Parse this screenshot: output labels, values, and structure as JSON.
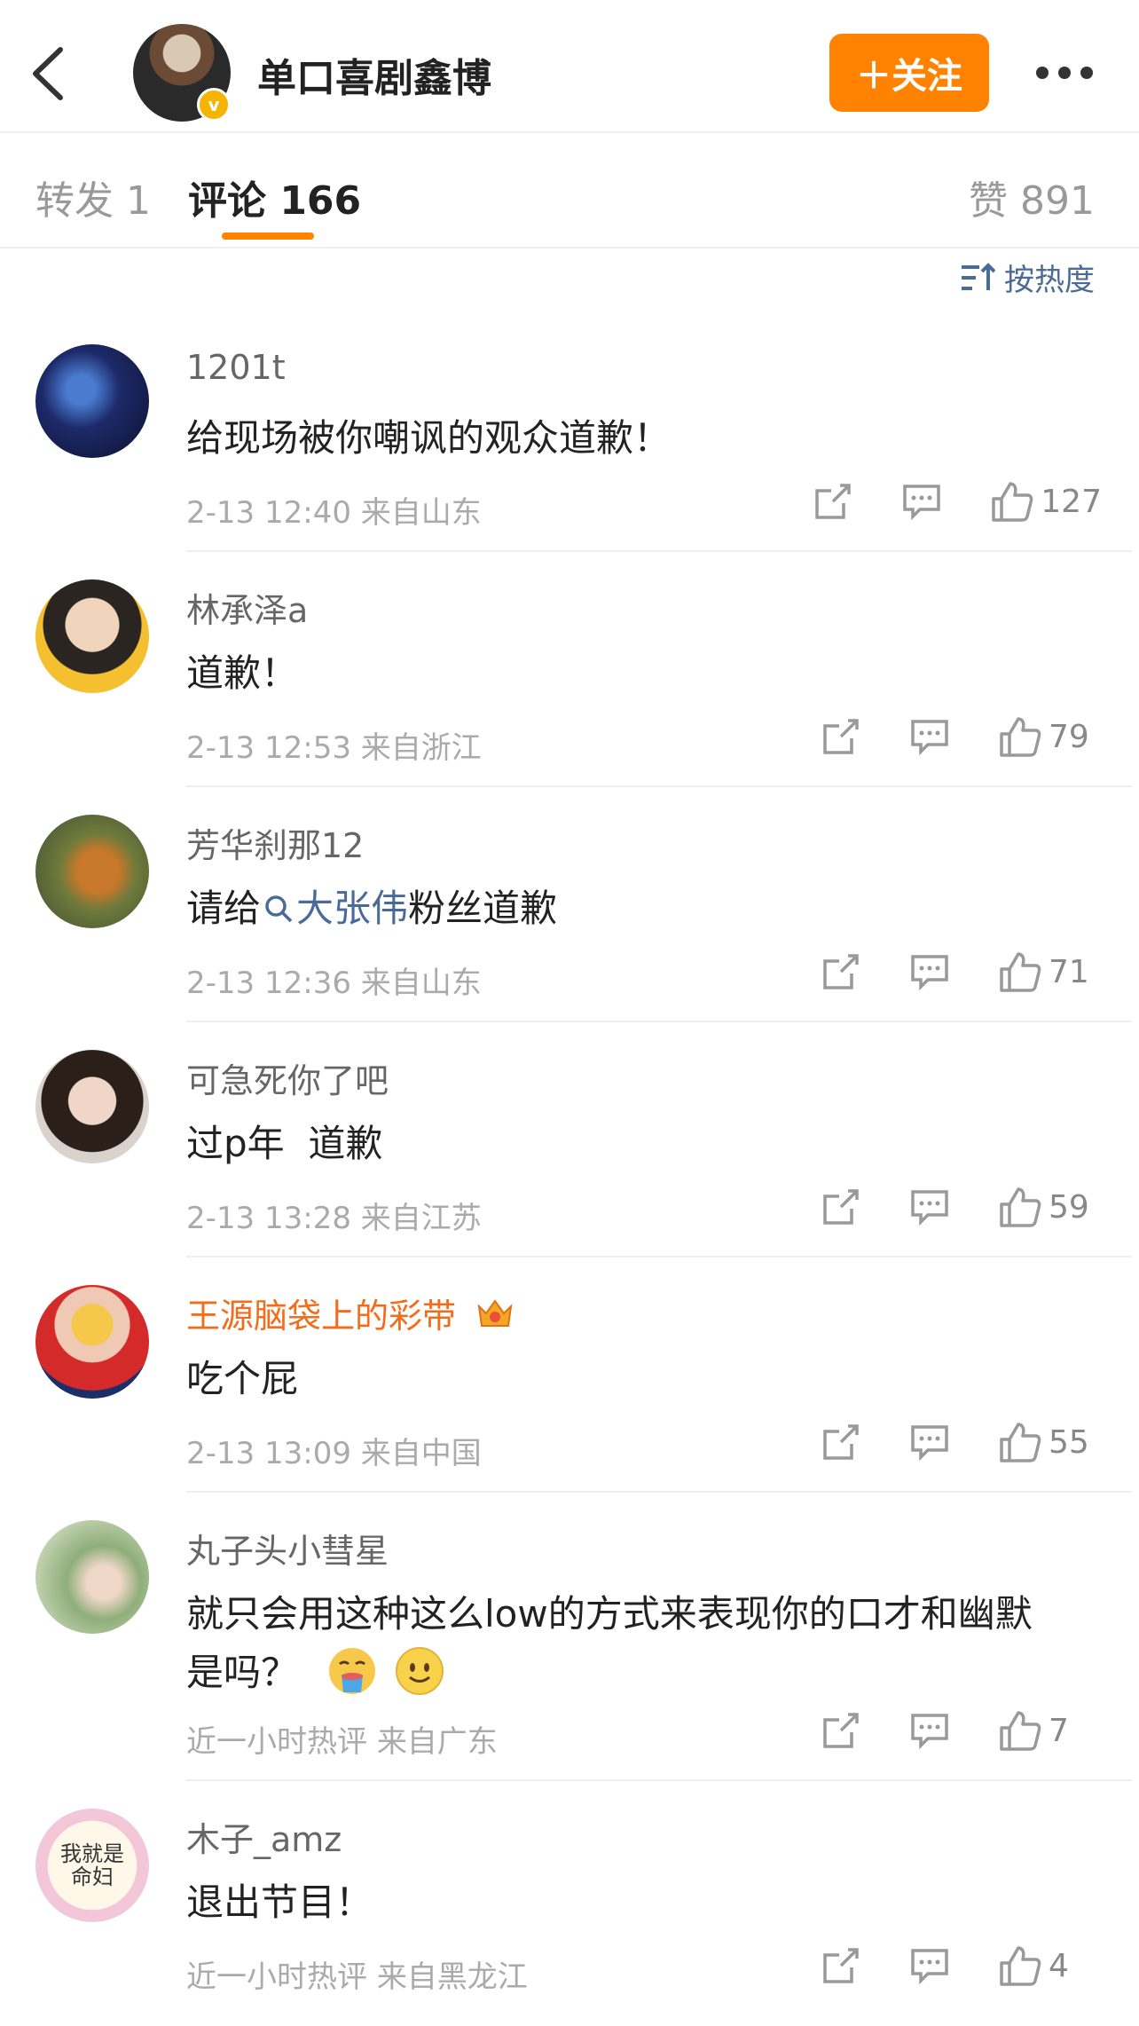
{
  "header": {
    "name": "单口喜剧鑫博",
    "verified_mark": "v",
    "follow_label": "＋关注"
  },
  "tabs": {
    "repost": "转发 1",
    "comments": "评论 166",
    "likes": "赞 891"
  },
  "sort": {
    "label": "按热度",
    "icon": "sort-icon"
  },
  "colors": {
    "accent": "#ff8200",
    "link": "#4a6a98",
    "vip_name": "#f26d1b"
  },
  "comments": [
    {
      "user": "1201t",
      "text": "给现场被你嘲讽的观众道歉！",
      "time": "2-13 12:40",
      "location": "来自山东",
      "likes": "127"
    },
    {
      "user": "林承泽a",
      "text": "道歉！",
      "time": "2-13 12:53",
      "location": "来自浙江",
      "likes": "79"
    },
    {
      "user": "芳华刹那12",
      "text_prefix": "请给",
      "text_tag": "大张伟",
      "text_suffix": "粉丝道歉",
      "time": "2-13 12:36",
      "location": "来自山东",
      "likes": "71"
    },
    {
      "user": "可急死你了吧",
      "text": "过p年  道歉",
      "time": "2-13 13:28",
      "location": "来自江苏",
      "likes": "59"
    },
    {
      "user": "王源脑袋上的彩带",
      "text": "吃个屁",
      "time": "2-13 13:09",
      "location": "来自中国",
      "likes": "55"
    },
    {
      "user": "丸子头小彗星",
      "text_line1": "就只会用这种这么low的方式来表现你的口才和幽默",
      "text_line2": "是吗？",
      "time": "近一小时热评",
      "location": "来自广东",
      "likes": "7"
    },
    {
      "user": "木子_amz",
      "text": "退出节目！",
      "time": "近一小时热评",
      "location": "来自黑龙江",
      "likes": "4",
      "avatar_text_1": "我就是",
      "avatar_text_2": "命妇"
    }
  ]
}
